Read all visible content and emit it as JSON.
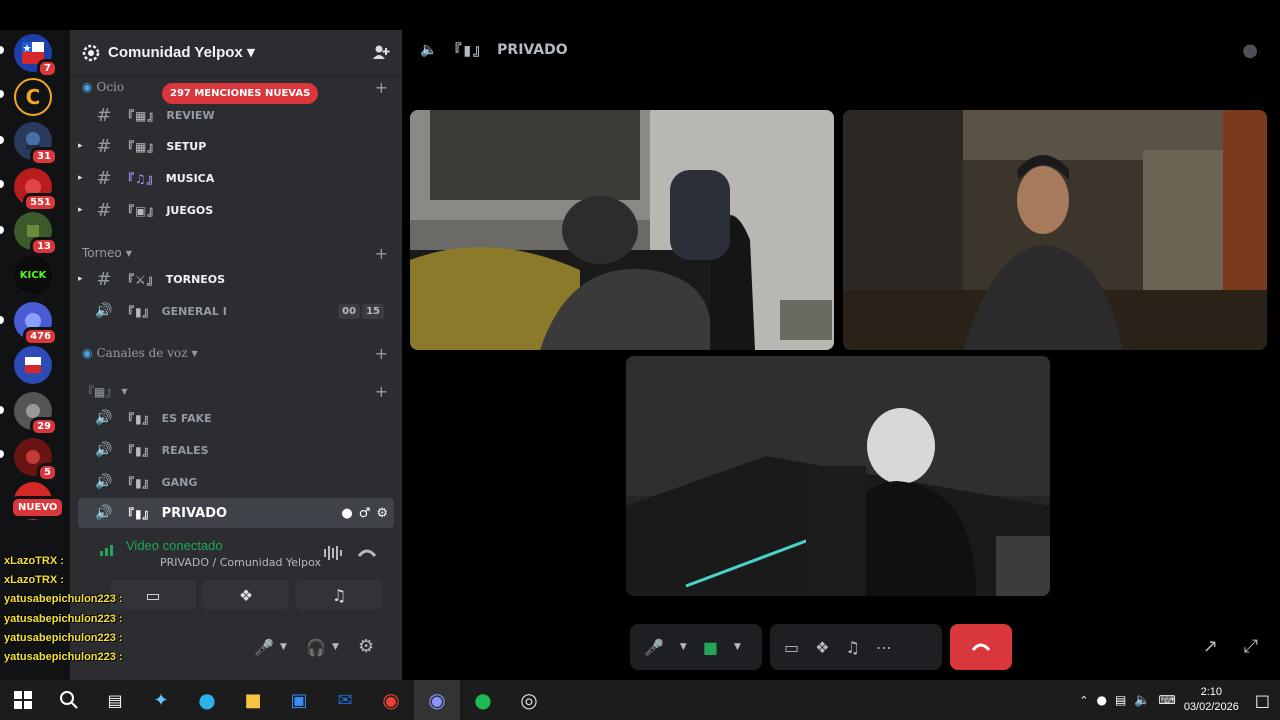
{
  "server": {
    "name": "Comunidad Yelpox",
    "mentions_badge": "297 MENCIONES NUEVAS"
  },
  "rail": {
    "badges": [
      "7",
      "31",
      "551",
      "13",
      "476",
      "29",
      "5"
    ],
    "kick_label": "KICK",
    "nuevo_label": "NUEVO"
  },
  "categories": {
    "ocio": "Ocio",
    "torneo": "Torneo",
    "canales_voz": "Canales de voz"
  },
  "channels": {
    "review": "REVIEW",
    "setup": "SETUP",
    "musica": "MUSICA",
    "juegos": "JUEGOS",
    "torneos": "TOrNEOS",
    "general": "GENERAL I",
    "general_counter": [
      "00",
      "15"
    ],
    "es_fake": "ES FAKE",
    "reales": "REALES",
    "gang": "GANG",
    "privado": "PRIVADO"
  },
  "voice_status": {
    "title": "Video conectado",
    "subtitle": "PRIVADO / Comunidad Yelpox"
  },
  "chat_overlay": [
    "xLazoTRX :",
    "xLazoTRX :",
    "yatusabepichulon223 :",
    "yatusabepichulon223 :",
    "yatusabepichulon223 :",
    "yatusabepichulon223 :",
    "yatusabepichulon223 :"
  ],
  "stage": {
    "channel_name": "PRIVADO"
  },
  "taskbar": {
    "time": "2:10",
    "date": "03/02/2026"
  },
  "colors": {
    "accent_red": "#da373c",
    "voice_green": "#23a55a",
    "sidebar": "#2b2d31",
    "rail": "#111214"
  }
}
